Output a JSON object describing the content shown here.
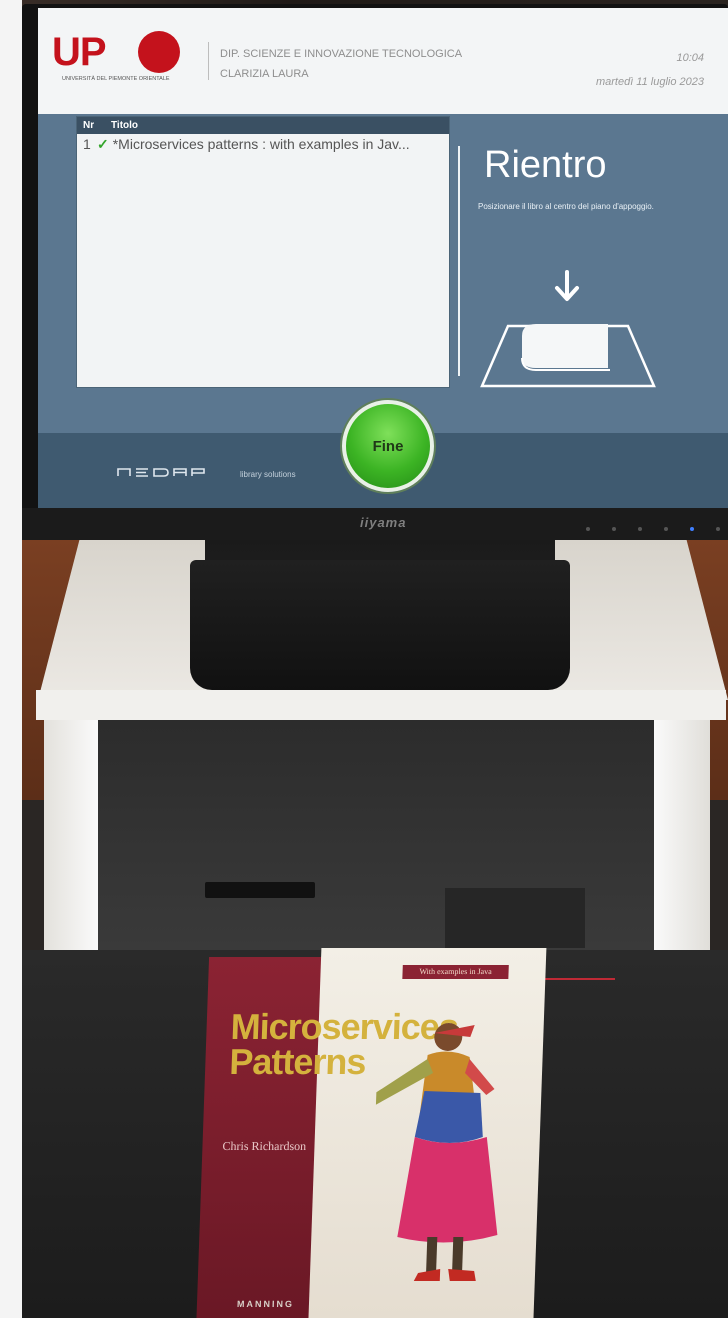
{
  "header": {
    "logo_text": "UP",
    "logo_subtitle": "UNIVERSITÀ DEL PIEMONTE ORIENTALE",
    "department": "DIP. SCIENZE E INNOVAZIONE TECNOLOGICA",
    "user": "CLARIZIA LAURA",
    "time": "10:04",
    "date": "martedì 11 luglio 2023"
  },
  "list": {
    "col_nr": "Nr",
    "col_title": "Titolo",
    "rows": [
      {
        "nr": "1",
        "title": "*Microservices patterns : with examples in Jav..."
      }
    ]
  },
  "panel": {
    "title": "Rientro",
    "instruction": "Posizionare il libro al centro del piano d'appoggio."
  },
  "footer": {
    "brand": "nedap",
    "tagline": "library solutions",
    "finish_button": "Fine"
  },
  "monitor": {
    "brand": "iiyama"
  },
  "book": {
    "tag": "With examples in Java",
    "title_line1": "Microservices",
    "title_line2": "Patterns",
    "author": "Chris Richardson",
    "publisher": "MANNING"
  },
  "colors": {
    "accent_green": "#3cb424",
    "screen_blue": "#5b7790",
    "upo_red": "#c4121c"
  }
}
